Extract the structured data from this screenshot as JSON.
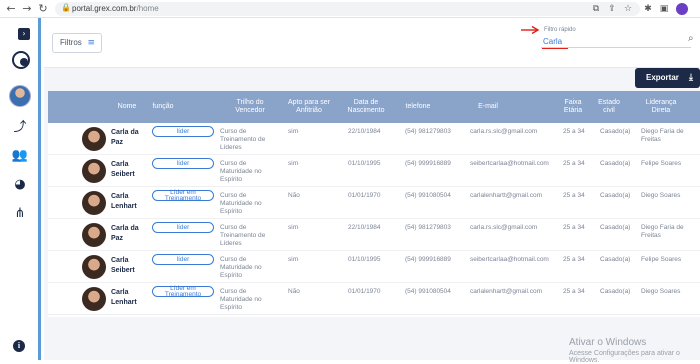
{
  "browser": {
    "url_host": "portal.grex.com.br",
    "url_path": "/home",
    "back_icon": "arrow-left-icon",
    "forward_icon": "arrow-right-icon",
    "reload_icon": "reload-icon"
  },
  "header": {
    "filters_label": "Filtros",
    "quick_filter_label": "Filtro rápido",
    "quick_filter_value": "Carla",
    "export_label": "Exportar"
  },
  "table": {
    "columns": [
      "Nome",
      "função",
      "Trilho do Vencedor",
      "Apto para ser Anfitrião",
      "Data de Nascimento",
      "telefone",
      "E-mail",
      "Faixa Etária",
      "Estado civil",
      "Liderança Direta"
    ],
    "rows": [
      {
        "name": "Carla da Paz",
        "funcao": "líder",
        "trilho": "Curso de Treinamento de Líderes",
        "apto": "sim",
        "nascimento": "22/10/1984",
        "telefone": "(54) 981279803",
        "email": "carla.rs.slc@gmail.com",
        "faixa": "25 a 34",
        "estado": "Casado(a)",
        "lideranca": "Diego Faria de Freitas"
      },
      {
        "name": "Carla Seibert",
        "funcao": "líder",
        "trilho": "Curso de Maturidade no Espírito",
        "apto": "sim",
        "nascimento": "01/10/1995",
        "telefone": "(54) 999916889",
        "email": "seibertcarlaa@hotmail.com",
        "faixa": "25 a 34",
        "estado": "Casado(a)",
        "lideranca": "Felipe Soares"
      },
      {
        "name": "Carla Lenhart",
        "funcao": "Líder em Treinamento",
        "trilho": "Curso de Maturidade no Espírito",
        "apto": "Não",
        "nascimento": "01/01/1970",
        "telefone": "(54) 991080504",
        "email": "carlalenhartt@gmail.com",
        "faixa": "25 a 34",
        "estado": "Casado(a)",
        "lideranca": "Diego Soares"
      },
      {
        "name": "Carla da Paz",
        "funcao": "líder",
        "trilho": "Curso de Treinamento de Líderes",
        "apto": "sim",
        "nascimento": "22/10/1984",
        "telefone": "(54) 981279803",
        "email": "carla.rs.slc@gmail.com",
        "faixa": "25 a 34",
        "estado": "Casado(a)",
        "lideranca": "Diego Faria de Freitas"
      },
      {
        "name": "Carla Seibert",
        "funcao": "líder",
        "trilho": "Curso de Maturidade no Espírito",
        "apto": "sim",
        "nascimento": "01/10/1995",
        "telefone": "(54) 999916889",
        "email": "seibertcarlaa@hotmail.com",
        "faixa": "25 a 34",
        "estado": "Casado(a)",
        "lideranca": "Felipe Soares"
      },
      {
        "name": "Carla Lenhart",
        "funcao": "Líder em Treinamento",
        "trilho": "Curso de Maturidade no Espírito",
        "apto": "Não",
        "nascimento": "01/01/1970",
        "telefone": "(54) 991080504",
        "email": "carlalenhartt@gmail.com",
        "faixa": "25 a 34",
        "estado": "Casado(a)",
        "lideranca": "Diego Soares"
      }
    ]
  },
  "watermark": {
    "title": "Ativar o Windows",
    "subtitle": "Acesse Configurações para ativar o Windows."
  },
  "sidebar": {
    "items": [
      {
        "icon": "trending-icon"
      },
      {
        "icon": "users-icon"
      },
      {
        "icon": "pie-chart-icon"
      },
      {
        "icon": "network-icon"
      }
    ]
  },
  "colors": {
    "accent": "#3a7bd5",
    "dark": "#1c2a48",
    "table_header": "#8aa3c9"
  }
}
